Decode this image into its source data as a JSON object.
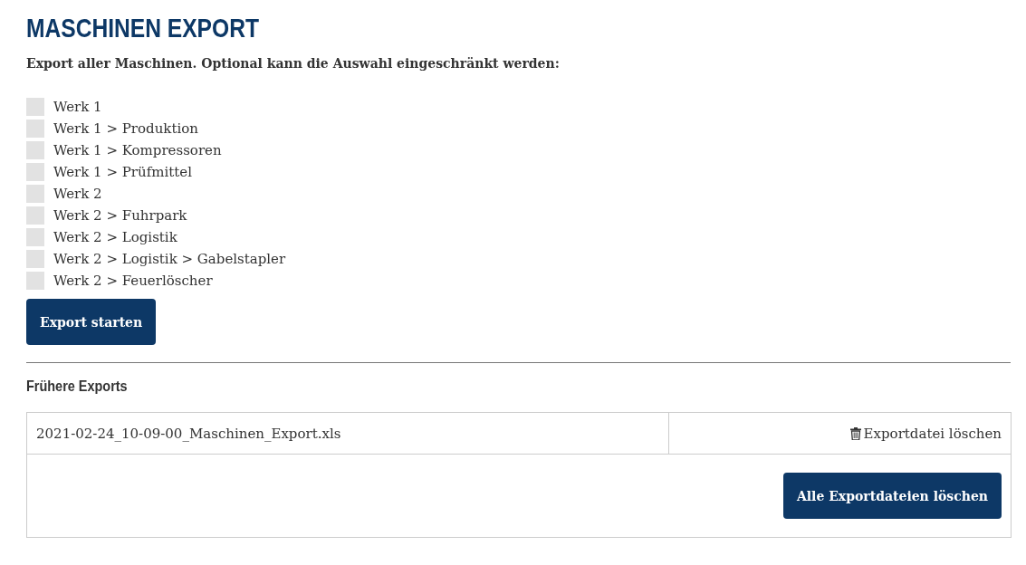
{
  "title": "MASCHINEN EXPORT",
  "intro": "Export aller Maschinen. Optional kann die Auswahl eingeschränkt werden:",
  "filters": [
    {
      "label": "Werk 1",
      "checked": false
    },
    {
      "label": "Werk 1 > Produktion",
      "checked": false
    },
    {
      "label": "Werk 1 > Kompressoren",
      "checked": false
    },
    {
      "label": "Werk 1 > Prüfmittel",
      "checked": false
    },
    {
      "label": "Werk 2",
      "checked": false
    },
    {
      "label": "Werk 2 > Fuhrpark",
      "checked": false
    },
    {
      "label": "Werk 2 > Logistik",
      "checked": false
    },
    {
      "label": "Werk 2 > Logistik > Gabelstapler",
      "checked": false
    },
    {
      "label": "Werk 2 > Feuerlöscher",
      "checked": false
    }
  ],
  "start_button": "Export starten",
  "history": {
    "title": "Frühere Exports",
    "files": [
      {
        "name": "2021-02-24_10-09-00_Maschinen_Export.xls",
        "delete": "Exportdatei löschen"
      }
    ],
    "delete_all": "Alle Exportdateien löschen"
  }
}
